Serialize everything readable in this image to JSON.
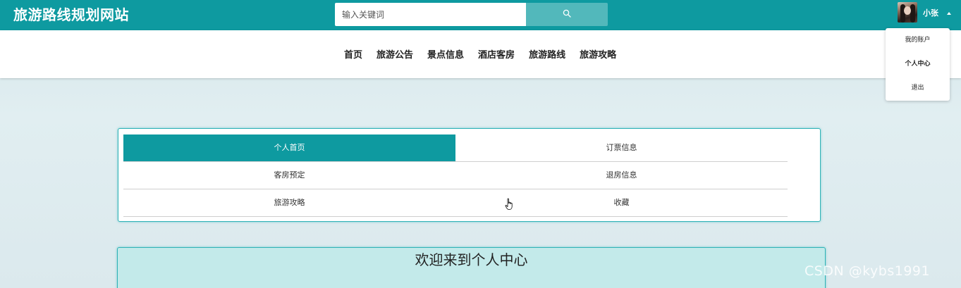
{
  "header": {
    "site_title": "旅游路线规划网站",
    "search": {
      "placeholder": "输入关键词",
      "button_icon": "search-icon"
    },
    "user": {
      "name": "小张",
      "avatar_icon": "user-avatar"
    }
  },
  "nav": {
    "items": [
      "首页",
      "旅游公告",
      "景点信息",
      "酒店客房",
      "旅游路线",
      "旅游攻略"
    ]
  },
  "user_menu": {
    "items": [
      {
        "label": "我的账户",
        "active": false
      },
      {
        "label": "个人中心",
        "active": true
      },
      {
        "label": "退出",
        "active": false
      }
    ]
  },
  "center_menu": {
    "items": [
      {
        "label": "个人首页",
        "active": true
      },
      {
        "label": "订票信息",
        "active": false
      },
      {
        "label": "客房预定",
        "active": false
      },
      {
        "label": "退房信息",
        "active": false
      },
      {
        "label": "旅游攻略",
        "active": false
      },
      {
        "label": "收藏",
        "active": false
      }
    ]
  },
  "welcome": {
    "title": "欢迎来到个人中心"
  },
  "watermark": "CSDN @kybs1991",
  "colors": {
    "primary": "#0e9aa0",
    "search_button": "#52b8bb",
    "panel_border": "#2fb3b7",
    "welcome_bg": "#c3eaea"
  }
}
